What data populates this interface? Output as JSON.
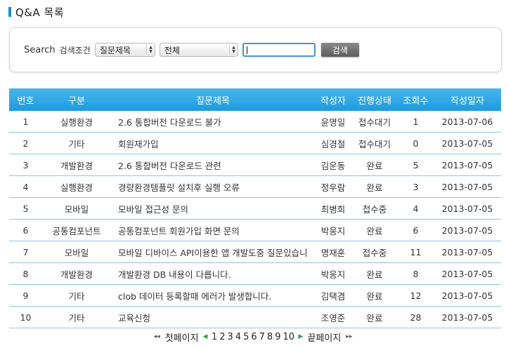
{
  "page": {
    "title": "Q&A 목록"
  },
  "search": {
    "label": "Search",
    "condition_label": "검색조건",
    "field_select": "질문제목",
    "status_select": "전체",
    "input_value": "",
    "button_label": "검색"
  },
  "table": {
    "headers": [
      "번호",
      "구분",
      "질문제목",
      "작성자",
      "진행상태",
      "조회수",
      "작성일자"
    ],
    "rows": [
      {
        "no": "1",
        "category": "실행환경",
        "title": "2.6 통합버전 다운로드 불가",
        "author": "윤명일",
        "status": "접수대기",
        "views": "1",
        "date": "2013-07-06"
      },
      {
        "no": "2",
        "category": "기타",
        "title": "회원재가입",
        "author": "심경철",
        "status": "접수대기",
        "views": "0",
        "date": "2013-07-05"
      },
      {
        "no": "3",
        "category": "개발환경",
        "title": "2.6 통합버전 다운로드 관련",
        "author": "김운동",
        "status": "완료",
        "views": "5",
        "date": "2013-07-05"
      },
      {
        "no": "4",
        "category": "실행환경",
        "title": "경량환경템플릿 설치후 실행 오류",
        "author": "정우람",
        "status": "완료",
        "views": "3",
        "date": "2013-07-05"
      },
      {
        "no": "5",
        "category": "모바일",
        "title": "모바일 접근성 문의",
        "author": "최병희",
        "status": "접수중",
        "views": "4",
        "date": "2013-07-05"
      },
      {
        "no": "6",
        "category": "공통컴포넌트",
        "title": "공통컴포넌트 회원가입 화면 문의",
        "author": "박웅지",
        "status": "완료",
        "views": "6",
        "date": "2013-07-05"
      },
      {
        "no": "7",
        "category": "모바일",
        "title": "모바일 디바이스 API이용한 앱 개발도중 질문있습니",
        "author": "명재훈",
        "status": "접수중",
        "views": "11",
        "date": "2013-07-05"
      },
      {
        "no": "8",
        "category": "개발환경",
        "title": "개발환경 DB 내용이 다릅니다.",
        "author": "박웅지",
        "status": "완료",
        "views": "8",
        "date": "2013-07-05"
      },
      {
        "no": "9",
        "category": "기타",
        "title": "clob 데이터 등록할때 에러가 발생합니다.",
        "author": "김택겸",
        "status": "완료",
        "views": "12",
        "date": "2013-07-05"
      },
      {
        "no": "10",
        "category": "기타",
        "title": "교육신청",
        "author": "조영준",
        "status": "완료",
        "views": "28",
        "date": "2013-07-05"
      }
    ]
  },
  "pager": {
    "first_label": "첫페이지",
    "last_label": "끝페이지",
    "pages": [
      "1",
      "2",
      "3",
      "4",
      "5",
      "6",
      "7",
      "8",
      "9",
      "10"
    ]
  },
  "colors": {
    "header_bg": "#1c9ae0",
    "accent": "#1e88c8",
    "row_border": "#8fc3e3"
  }
}
